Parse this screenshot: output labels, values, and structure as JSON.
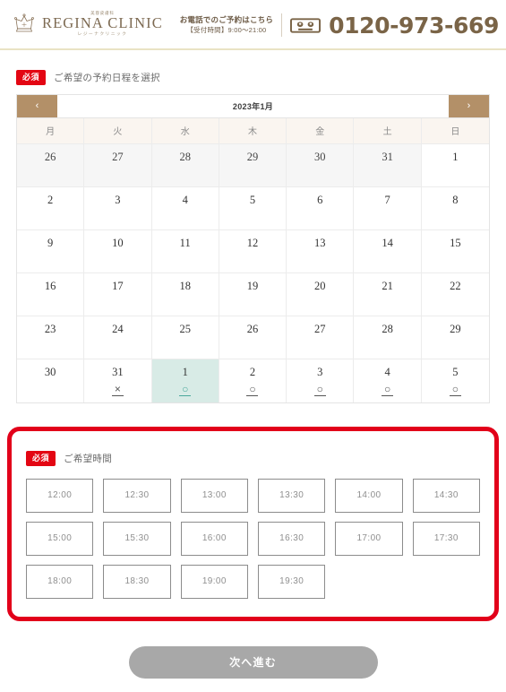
{
  "header": {
    "brand": {
      "superscript": "美容皮膚科",
      "name": "REGINA CLINIC",
      "subscript": "レジーナクリニック",
      "crown_icon": "crown-icon"
    },
    "contact": {
      "line1": "お電話でのご予約はこちら",
      "line2": "【受付時間】9:00〜21:00",
      "freedial_icon": "freedial-icon",
      "phone": "0120-973-669"
    }
  },
  "date_section": {
    "required_badge": "必須",
    "label": "ご希望の予約日程を選択",
    "calendar": {
      "prev_label": "‹",
      "next_label": "›",
      "title": "2023年1月",
      "weekdays": [
        "月",
        "火",
        "水",
        "木",
        "金",
        "土",
        "日"
      ],
      "cells": [
        {
          "day": "26",
          "mark": "",
          "state": "muted"
        },
        {
          "day": "27",
          "mark": "",
          "state": "muted"
        },
        {
          "day": "28",
          "mark": "",
          "state": "muted"
        },
        {
          "day": "29",
          "mark": "",
          "state": "muted"
        },
        {
          "day": "30",
          "mark": "",
          "state": "muted"
        },
        {
          "day": "31",
          "mark": "",
          "state": "muted"
        },
        {
          "day": "1",
          "mark": "",
          "state": "normal"
        },
        {
          "day": "2",
          "mark": "",
          "state": "normal"
        },
        {
          "day": "3",
          "mark": "",
          "state": "normal"
        },
        {
          "day": "4",
          "mark": "",
          "state": "normal"
        },
        {
          "day": "5",
          "mark": "",
          "state": "normal"
        },
        {
          "day": "6",
          "mark": "",
          "state": "normal"
        },
        {
          "day": "7",
          "mark": "",
          "state": "normal"
        },
        {
          "day": "8",
          "mark": "",
          "state": "normal"
        },
        {
          "day": "9",
          "mark": "",
          "state": "normal"
        },
        {
          "day": "10",
          "mark": "",
          "state": "normal"
        },
        {
          "day": "11",
          "mark": "",
          "state": "normal"
        },
        {
          "day": "12",
          "mark": "",
          "state": "normal"
        },
        {
          "day": "13",
          "mark": "",
          "state": "normal"
        },
        {
          "day": "14",
          "mark": "",
          "state": "normal"
        },
        {
          "day": "15",
          "mark": "",
          "state": "normal"
        },
        {
          "day": "16",
          "mark": "",
          "state": "normal"
        },
        {
          "day": "17",
          "mark": "",
          "state": "normal"
        },
        {
          "day": "18",
          "mark": "",
          "state": "normal"
        },
        {
          "day": "19",
          "mark": "",
          "state": "normal"
        },
        {
          "day": "20",
          "mark": "",
          "state": "normal"
        },
        {
          "day": "21",
          "mark": "",
          "state": "normal"
        },
        {
          "day": "22",
          "mark": "",
          "state": "normal"
        },
        {
          "day": "23",
          "mark": "",
          "state": "normal"
        },
        {
          "day": "24",
          "mark": "",
          "state": "normal"
        },
        {
          "day": "25",
          "mark": "",
          "state": "normal"
        },
        {
          "day": "26",
          "mark": "",
          "state": "normal"
        },
        {
          "day": "27",
          "mark": "",
          "state": "normal"
        },
        {
          "day": "28",
          "mark": "",
          "state": "normal"
        },
        {
          "day": "29",
          "mark": "",
          "state": "normal"
        },
        {
          "day": "30",
          "mark": "",
          "state": "normal"
        },
        {
          "day": "31",
          "mark": "×",
          "state": "normal"
        },
        {
          "day": "1",
          "mark": "○",
          "state": "selected"
        },
        {
          "day": "2",
          "mark": "○",
          "state": "normal"
        },
        {
          "day": "3",
          "mark": "○",
          "state": "normal"
        },
        {
          "day": "4",
          "mark": "○",
          "state": "normal"
        },
        {
          "day": "5",
          "mark": "○",
          "state": "normal"
        }
      ]
    }
  },
  "time_section": {
    "required_badge": "必須",
    "label": "ご希望時間",
    "slots": [
      "12:00",
      "12:30",
      "13:00",
      "13:30",
      "14:00",
      "14:30",
      "15:00",
      "15:30",
      "16:00",
      "16:30",
      "17:00",
      "17:30",
      "18:00",
      "18:30",
      "19:00",
      "19:30"
    ]
  },
  "footer": {
    "submit_label": "次へ進む"
  },
  "colors": {
    "brand_brown": "#7d6a52",
    "nav_tan": "#b39068",
    "required_red": "#e30613",
    "box_red": "#e2001a",
    "selected_teal": "#d8ebe6",
    "mark_teal": "#4aa89b",
    "submit_gray": "#a8a8a8"
  }
}
